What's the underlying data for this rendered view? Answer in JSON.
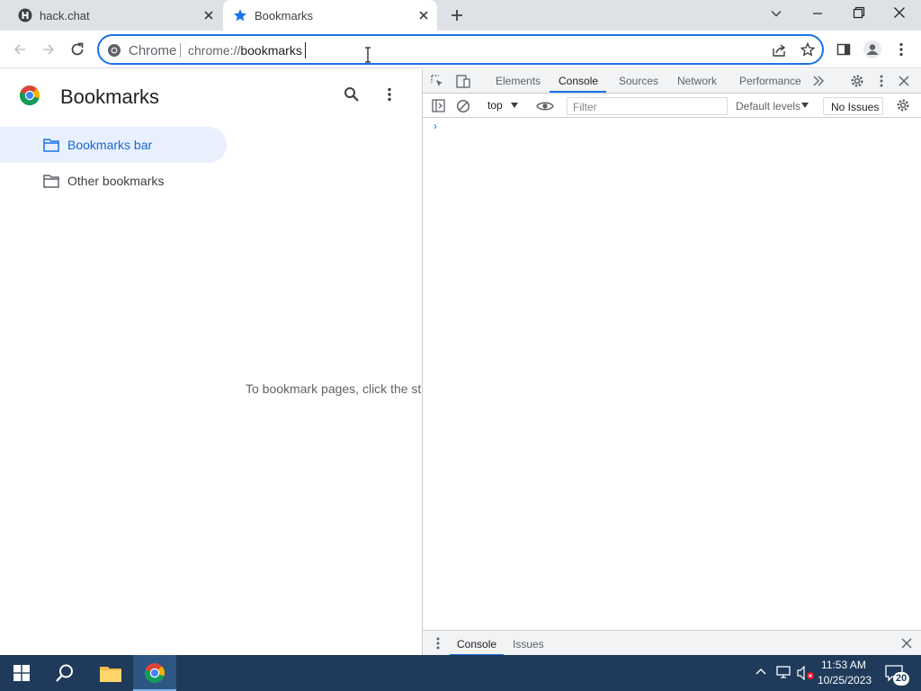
{
  "browser": {
    "tabs": [
      {
        "title": "hack.chat",
        "active": false
      },
      {
        "title": "Bookmarks",
        "active": true
      }
    ],
    "omnibox": {
      "chip_label": "Chrome",
      "url_scheme": "chrome://",
      "url_rest": "bookmarks"
    }
  },
  "bookmarks_page": {
    "title": "Bookmarks",
    "folders": [
      {
        "label": "Bookmarks bar",
        "selected": true
      },
      {
        "label": "Other bookmarks",
        "selected": false
      }
    ],
    "empty_message": "To bookmark pages, click the st"
  },
  "devtools": {
    "tabs": [
      "Elements",
      "Console",
      "Sources",
      "Network",
      "Performance"
    ],
    "active_tab": "Console",
    "context": "top",
    "filter_placeholder": "Filter",
    "levels": "Default levels",
    "issues": "No Issues",
    "prompt": "›",
    "drawer_tabs": [
      "Console",
      "Issues"
    ]
  },
  "taskbar": {
    "time": "11:53 AM",
    "date": "10/25/2023",
    "notification_count": "20"
  },
  "colors": {
    "accent": "#1a73e8",
    "selected_folder_bg": "#e8f0fe",
    "taskbar": "#1f3a5a"
  }
}
